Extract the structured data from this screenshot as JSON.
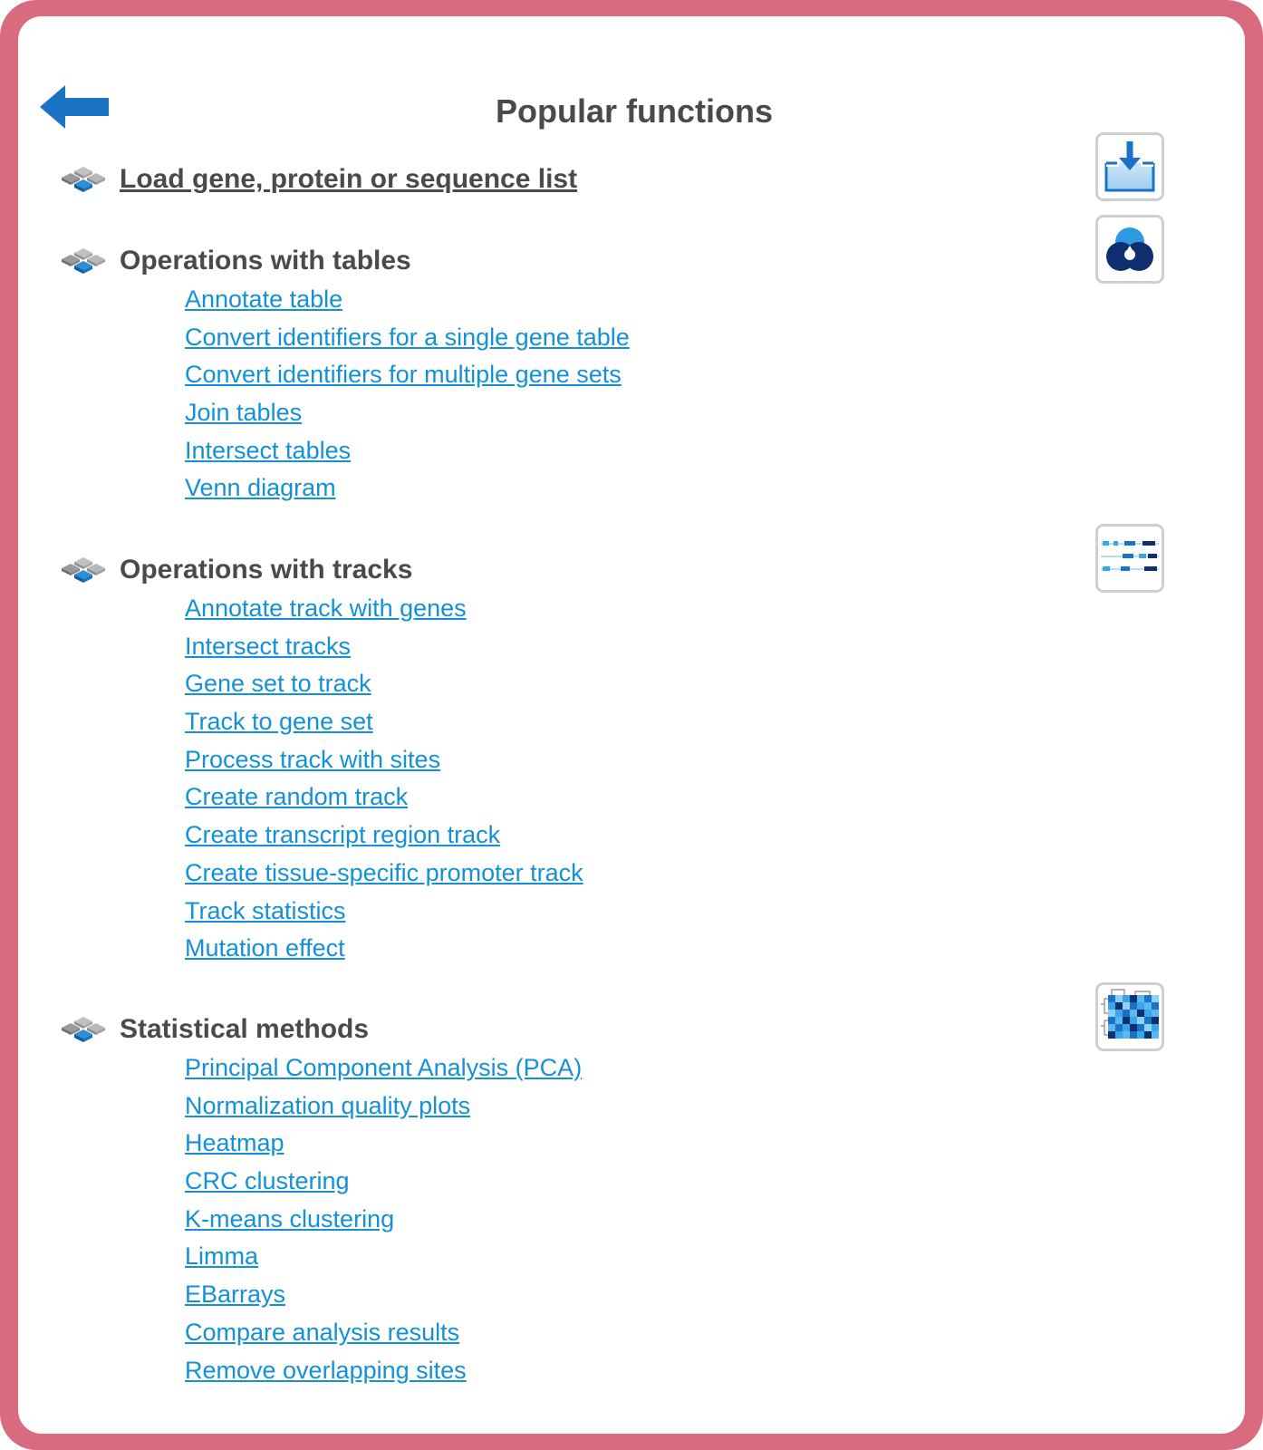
{
  "page": {
    "title": "Popular functions",
    "back_icon": "back-arrow-icon",
    "accent_color": "#1391d6",
    "frame_color": "#d96b7e",
    "heading_color": "#4a4a4a"
  },
  "load": {
    "label": "Load gene, protein or sequence list",
    "icon": "import-icon"
  },
  "tables": {
    "title": "Operations with tables",
    "icon": "venn-diagram-icon",
    "links": [
      "Annotate table",
      "Convert identifiers for a single gene table",
      "Convert identifiers for multiple gene sets",
      "Join tables",
      "Intersect tables",
      "Venn diagram"
    ]
  },
  "tracks": {
    "title": "Operations with tracks",
    "icon": "tracks-icon",
    "links": [
      "Annotate track with genes",
      "Intersect tracks",
      "Gene set to track",
      "Track to gene set",
      "Process track with sites",
      "Create random track",
      "Create transcript region track",
      "Create tissue-specific promoter track",
      "Track statistics",
      "Mutation effect"
    ]
  },
  "stats": {
    "title": "Statistical methods",
    "icon": "heatmap-icon",
    "links": [
      "Principal Component Analysis (PCA)",
      "Normalization quality plots",
      "Heatmap",
      "CRC clustering",
      "K-means clustering",
      "Limma",
      "EBarrays",
      "Compare analysis results",
      "Remove overlapping sites"
    ]
  }
}
